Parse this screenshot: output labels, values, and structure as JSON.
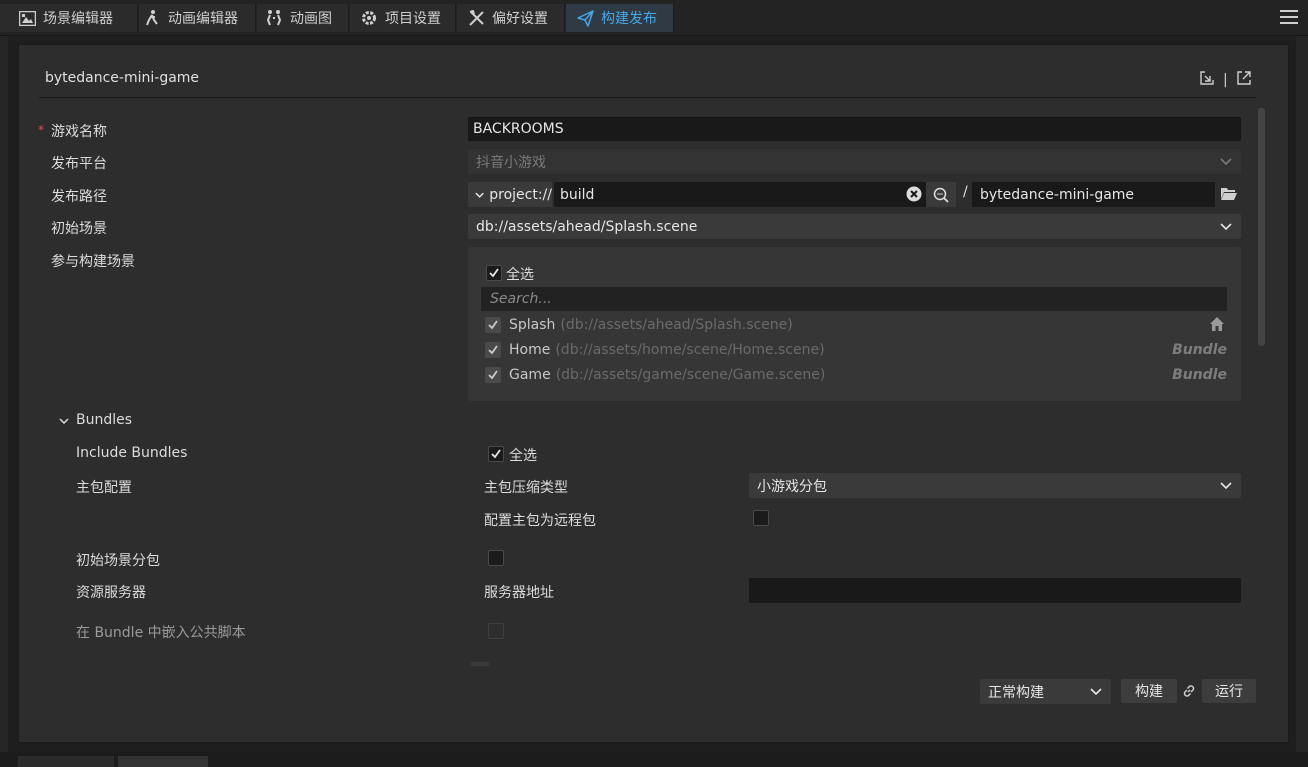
{
  "tabs": [
    {
      "label": "场景编辑器",
      "icon": "scene-editor-icon"
    },
    {
      "label": "动画编辑器",
      "icon": "animation-editor-icon"
    },
    {
      "label": "动画图",
      "icon": "animation-graph-icon"
    },
    {
      "label": "项目设置",
      "icon": "gear-icon"
    },
    {
      "label": "偏好设置",
      "icon": "tools-icon"
    },
    {
      "label": "构建发布",
      "icon": "send-icon",
      "active": true
    }
  ],
  "dialog": {
    "title": "bytedance-mini-game",
    "header_separator": "|"
  },
  "form": {
    "game_name": {
      "label": "游戏名称",
      "required_mark": "*",
      "value": "BACKROOMS"
    },
    "platform": {
      "label": "发布平台",
      "value": "抖音小游戏"
    },
    "build_path": {
      "label": "发布路径",
      "protocol": "project://",
      "path": "build",
      "separator": "/",
      "output_name": "bytedance-mini-game"
    },
    "start_scene": {
      "label": "初始场景",
      "value": "db://assets/ahead/Splash.scene"
    },
    "build_scenes": {
      "label": "参与构建场景",
      "select_all_label": "全选",
      "search_placeholder": "Search...",
      "items": [
        {
          "name": "Splash",
          "path": "(db://assets/ahead/Splash.scene)",
          "tag": "",
          "checked": true
        },
        {
          "name": "Home",
          "path": "(db://assets/home/scene/Home.scene)",
          "tag": "Bundle",
          "checked": true
        },
        {
          "name": "Game",
          "path": "(db://assets/game/scene/Game.scene)",
          "tag": "Bundle",
          "checked": true
        }
      ]
    },
    "bundles": {
      "section_label": "Bundles",
      "include_bundles": {
        "label": "Include Bundles",
        "select_all_label": "全选",
        "checked": true
      },
      "main_package": {
        "label": "主包配置",
        "compression": {
          "label": "主包压缩类型",
          "value": "小游戏分包"
        },
        "remote": {
          "label": "配置主包为远程包",
          "checked": false
        }
      },
      "start_scene_subpackage": {
        "label": "初始场景分包",
        "checked": false
      },
      "resource_server": {
        "label": "资源服务器",
        "address_label": "服务器地址",
        "value": ""
      },
      "embed_scripts": {
        "label": "在 Bundle 中嵌入公共脚本",
        "checked": false
      }
    }
  },
  "footer": {
    "build_mode": "正常构建",
    "build_label": "构建",
    "run_label": "运行"
  },
  "colors": {
    "accent": "#46a7e6",
    "required": "#e05252"
  }
}
